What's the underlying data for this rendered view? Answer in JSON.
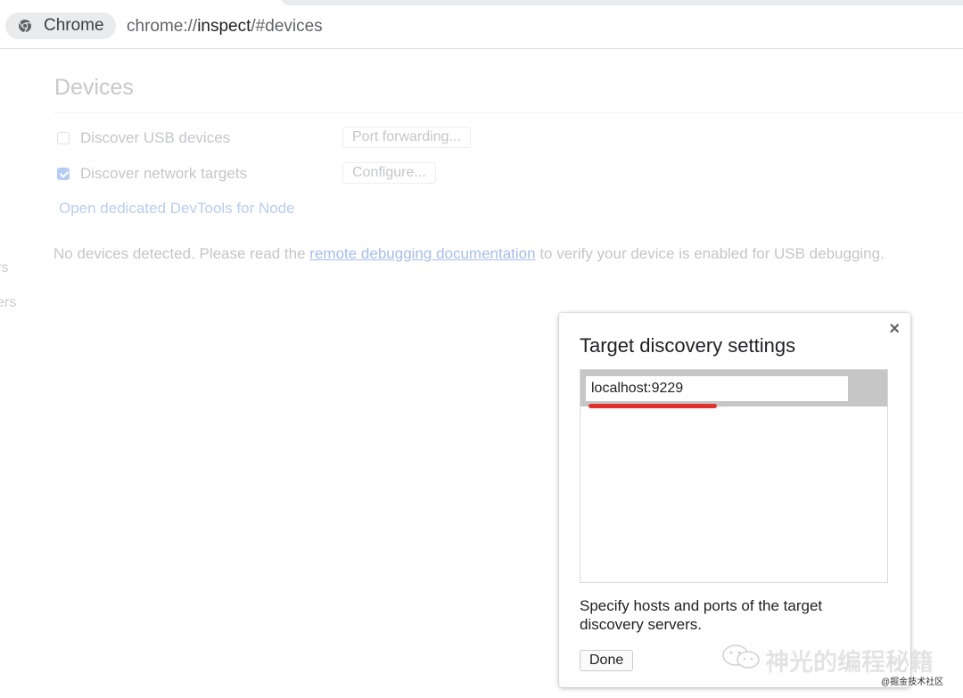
{
  "browser": {
    "chip_label": "Chrome",
    "url_prefix": "chrome://",
    "url_host": "inspect",
    "url_suffix": "/#devices"
  },
  "sidebar": {
    "fragments": [
      "rs",
      "ers"
    ]
  },
  "devices": {
    "title": "Devices",
    "discover_usb": {
      "label": "Discover USB devices",
      "checked": false
    },
    "port_forwarding_button": "Port forwarding...",
    "discover_network": {
      "label": "Discover network targets",
      "checked": true
    },
    "configure_button": "Configure...",
    "node_link": "Open dedicated DevTools for Node",
    "no_devices_prefix": "No devices detected. Please read the ",
    "no_devices_link": "remote debugging documentation",
    "no_devices_suffix": " to verify your device is enabled for USB debugging."
  },
  "dialog": {
    "close_glyph": "×",
    "title": "Target discovery settings",
    "entries": [
      "localhost:9229"
    ],
    "description": "Specify hosts and ports of the target discovery servers.",
    "done_button": "Done"
  },
  "annotation": {
    "underline_color": "#e0322c"
  },
  "watermark": {
    "text": "神光的编程秘籍",
    "small_text": "@掘金技术社区"
  },
  "colors": {
    "accent_blue": "#1a73e8",
    "dimmed_text": "#c4c6c9"
  }
}
